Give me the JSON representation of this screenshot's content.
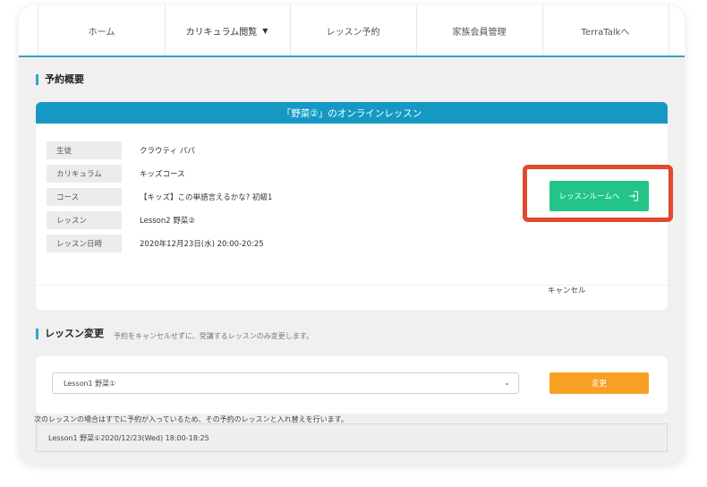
{
  "nav": {
    "items": [
      {
        "label": "ホーム"
      },
      {
        "label": "カリキュラム閲覧"
      },
      {
        "label": "レッスン予約"
      },
      {
        "label": "家族会員管理"
      },
      {
        "label": "TerraTalkへ"
      }
    ]
  },
  "summary": {
    "title": "予約概要",
    "header": "「野菜②」のオンラインレッスン",
    "rows": [
      {
        "label": "生徒",
        "value": "クラウティ パパ"
      },
      {
        "label": "カリキュラム",
        "value": "キッズコース"
      },
      {
        "label": "コース",
        "value": "【キッズ】この単語言えるかな? 初級1"
      },
      {
        "label": "レッスン",
        "value": "Lesson2 野菜②"
      },
      {
        "label": "レッスン日時",
        "value": "2020年12月23日(水) 20:00-20:25"
      }
    ],
    "room_button": "レッスンルームへ",
    "cancel": "キャンセル"
  },
  "change": {
    "title": "レッスン変更",
    "subtitle": "予約をキャンセルせずに、受講するレッスンのみ変更します。",
    "select_value": "Lesson1 野菜①",
    "button": "変更",
    "notice": "次のレッスンの場合はすでに予約が入っているため、その予約のレッスンと入れ替えを行います。",
    "swap": "Lesson1 野菜①2020/12/23(Wed) 18:00-18:25"
  },
  "colors": {
    "accent": "#1599c4",
    "room_button": "#22c587",
    "change_button": "#f7a023",
    "highlight": "#e2492f"
  }
}
